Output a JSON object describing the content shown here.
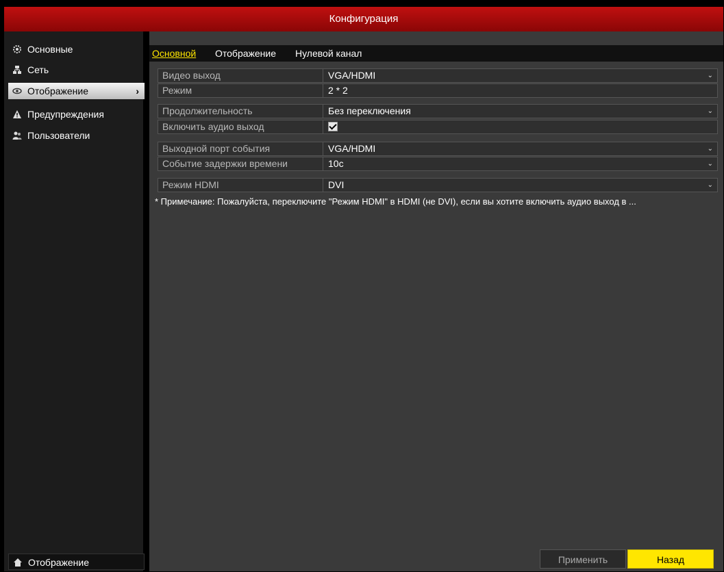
{
  "window": {
    "title": "Конфигурация"
  },
  "sidebar": {
    "items": [
      {
        "label": "Основные",
        "icon": "gear-icon"
      },
      {
        "label": "Сеть",
        "icon": "network-icon"
      },
      {
        "label": "Отображение",
        "icon": "eye-icon",
        "active": true
      },
      {
        "label": "Предупреждения",
        "icon": "warning-icon"
      },
      {
        "label": "Пользователи",
        "icon": "users-icon"
      }
    ],
    "footer": {
      "label": "Отображение",
      "icon": "home-icon"
    }
  },
  "tabs": [
    "Основной",
    "Отображение",
    "Нулевой канал"
  ],
  "settings": [
    {
      "label": "Видео выход",
      "value": "VGA/HDMI",
      "type": "select"
    },
    {
      "label": "Режим",
      "value": "2 * 2",
      "type": "select"
    },
    {
      "label": "Продолжительность",
      "value": "Без переключения",
      "type": "select"
    },
    {
      "label": "Включить аудио выход",
      "value": "checked",
      "type": "checkbox"
    },
    {
      "label": "Выходной порт события",
      "value": "VGA/HDMI",
      "type": "select"
    },
    {
      "label": "Событие задержки времени",
      "value": "10с",
      "type": "select"
    },
    {
      "label": "Режим HDMI",
      "value": "DVI",
      "type": "select"
    }
  ],
  "note": "* Примечание: Пожалуйста, переключите \"Режим HDMI\" в HDMI (не DVI), если вы хотите включить аудио выход в ...",
  "buttons": {
    "apply": "Применить",
    "back": "Назад"
  },
  "colors": {
    "title_bar": "#a00a0a",
    "accent": "#ffe600",
    "panel": "#3a3a3a"
  }
}
